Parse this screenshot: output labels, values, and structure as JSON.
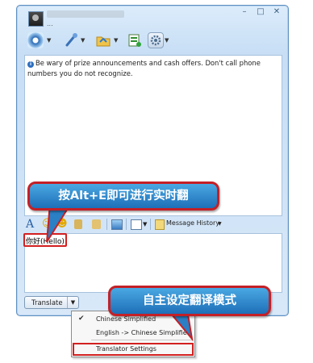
{
  "window": {
    "contact_status": "...",
    "controls": {
      "minimize": "–",
      "maximize": "□",
      "close": "✕"
    }
  },
  "toolbar": {
    "items": [
      {
        "name": "webcam-icon",
        "glyph": "◉"
      },
      {
        "name": "microphone-icon",
        "glyph": "✎"
      },
      {
        "name": "folder-icon",
        "glyph": "▤"
      },
      {
        "name": "list-icon",
        "glyph": "☰"
      },
      {
        "name": "settings-icon",
        "glyph": "⚙"
      }
    ]
  },
  "warning": {
    "icon": "i",
    "text": "Be wary of prize announcements and cash offers. Don't call phone numbers you do not recognize."
  },
  "format_toolbar": {
    "font_button": "A",
    "emoticon1": "☺",
    "emoticon2": "☻",
    "message_history": "Message History"
  },
  "input": {
    "text": "你好(Hello)"
  },
  "translate": {
    "label": "Translate",
    "dropdown_arrow": "▼"
  },
  "menu": {
    "items": [
      {
        "label": "Chinese Simplified",
        "checked": true
      },
      {
        "label": "English -> Chinese Simplified",
        "checked": false
      },
      {
        "label": "Translator Settings",
        "checked": false
      }
    ],
    "check_glyph": "✔"
  },
  "callouts": {
    "shortcut": "按Alt+E即可进行实时翻",
    "settings": "自主设定翻译模式"
  },
  "colors": {
    "callout_fill": "#2f86cc",
    "callout_border": "#c42026",
    "highlight_border": "#d32020"
  }
}
